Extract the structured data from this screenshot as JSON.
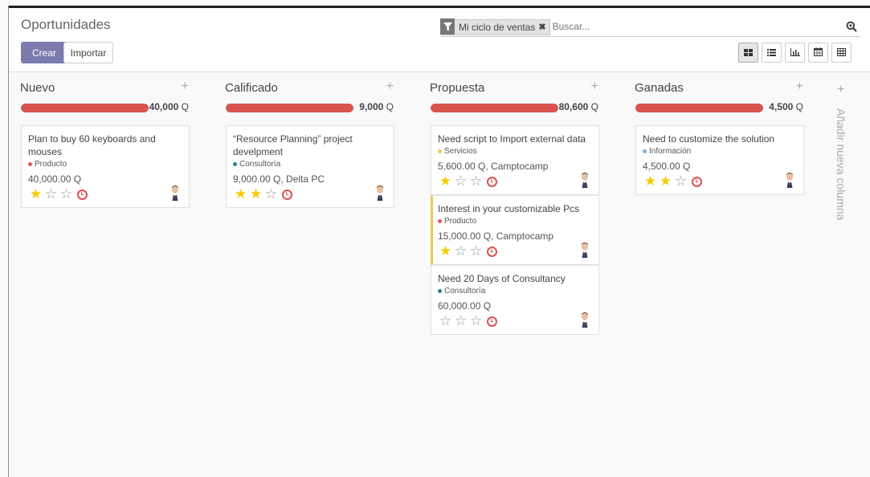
{
  "header": {
    "title": "Oportunidades",
    "create_label": "Crear",
    "import_label": "Importar"
  },
  "search": {
    "facet_label": "Mi ciclo de ventas",
    "placeholder": "Buscar..."
  },
  "views": [
    "kanban-icon",
    "list-icon",
    "graph-icon",
    "calendar-icon",
    "pivot-icon"
  ],
  "columns": [
    {
      "title": "Nuevo",
      "total": "40,000",
      "unit": "Q",
      "progress": 1.0,
      "cards": [
        {
          "title": "Plan to buy 60 keyboards and mouses",
          "tag": "Producto",
          "tag_color": "#e05757",
          "amount": "40,000.00 Q",
          "stars": 1,
          "highlight": false
        }
      ]
    },
    {
      "title": "Calificado",
      "total": "9,000",
      "unit": "Q",
      "progress": 1.0,
      "cards": [
        {
          "title": "“Resource Planning” project develpment",
          "tag": "Consultoría",
          "tag_color": "#2e7d8c",
          "amount": "9,000.00 Q, Delta PC",
          "stars": 2,
          "highlight": false
        }
      ]
    },
    {
      "title": "Propuesta",
      "total": "80,600",
      "unit": "Q",
      "progress": 1.0,
      "cards": [
        {
          "title": "Need script to Import external data",
          "tag": "Servicios",
          "tag_color": "#f0c94a",
          "amount": "5,600.00 Q, Camptocamp",
          "stars": 1,
          "highlight": false
        },
        {
          "title": "Interest in your customizable Pcs",
          "tag": "Producto",
          "tag_color": "#e05757",
          "amount": "15,000.00 Q, Camptocamp",
          "stars": 1,
          "highlight": true
        },
        {
          "title": "Need 20 Days of Consultancy",
          "tag": "Consultoría",
          "tag_color": "#2e7d8c",
          "amount": "60,000.00 Q",
          "stars": 0,
          "highlight": false
        }
      ]
    },
    {
      "title": "Ganadas",
      "total": "4,500",
      "unit": "Q",
      "progress": 1.0,
      "cards": [
        {
          "title": "Need to customize the solution",
          "tag": "Información",
          "tag_color": "#6cb5e0",
          "amount": "4,500.00 Q",
          "stars": 2,
          "highlight": false
        }
      ]
    }
  ],
  "add_column_label": "Añadir nueva columna",
  "colors": {
    "primary": "#7c7bad",
    "progress": "#d9534f",
    "star": "#f3cc00"
  }
}
